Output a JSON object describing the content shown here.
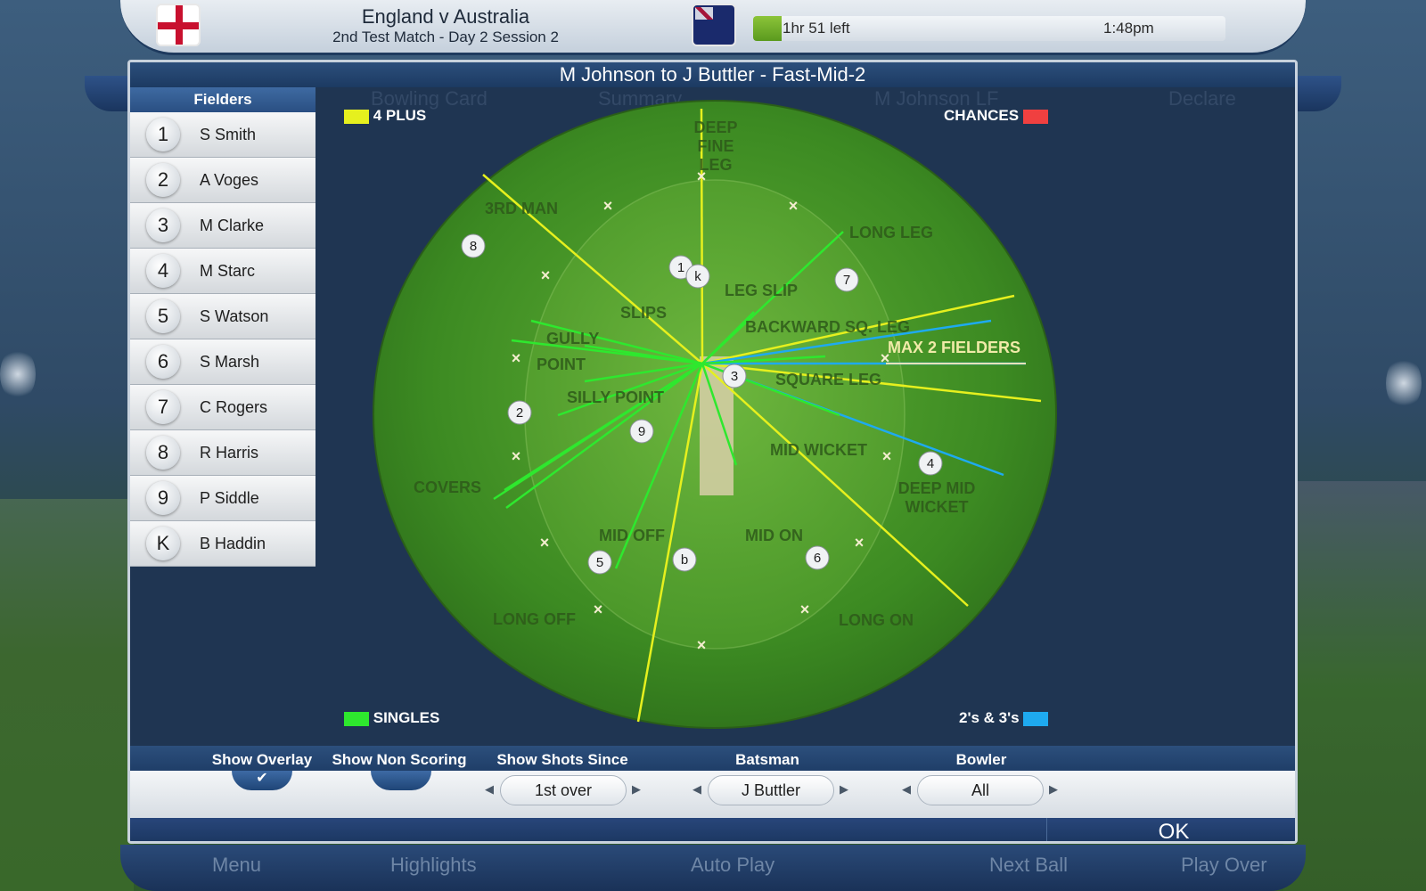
{
  "header": {
    "match_title": "England v Australia",
    "match_subtitle": "2nd Test Match - Day 2 Session 2",
    "time_left": "1hr 51 left",
    "clock": "1:48pm",
    "time_progress": 0.06
  },
  "dialog": {
    "title": "M Johnson to J Buttler - Fast-Mid-2",
    "background_ghost": {
      "bowling_card": "Bowling Card",
      "summary": "Summary",
      "bowler": "M Johnson LF",
      "declare": "Declare"
    }
  },
  "fielders": {
    "header": "Fielders",
    "items": [
      {
        "badge": "1",
        "name": "S Smith"
      },
      {
        "badge": "2",
        "name": "A Voges"
      },
      {
        "badge": "3",
        "name": "M Clarke"
      },
      {
        "badge": "4",
        "name": "M Starc"
      },
      {
        "badge": "5",
        "name": "S Watson"
      },
      {
        "badge": "6",
        "name": "S Marsh"
      },
      {
        "badge": "7",
        "name": "C Rogers"
      },
      {
        "badge": "8",
        "name": "R Harris"
      },
      {
        "badge": "9",
        "name": "P Siddle"
      },
      {
        "badge": "K",
        "name": "B Haddin"
      }
    ]
  },
  "legend": {
    "four_plus": "4 PLUS",
    "chances": "CHANCES",
    "singles": "SINGLES",
    "twos_threes": "2's & 3's",
    "colors": {
      "four_plus": "#e6f01e",
      "chances": "#f04040",
      "singles": "#2ee82e",
      "twos_threes": "#1eaaf0"
    }
  },
  "field": {
    "positions": {
      "deep_fine_leg": "DEEP\nFINE\nLEG",
      "third_man": "3RD MAN",
      "long_leg": "LONG LEG",
      "leg_slip": "LEG SLIP",
      "slips": "SLIPS",
      "gully": "GULLY",
      "point": "POINT",
      "backward_sq_leg": "BACKWARD SQ. LEG",
      "max_fielders": "MAX 2 FIELDERS",
      "square_leg": "SQUARE LEG",
      "silly_point": "SILLY POINT",
      "mid_wicket": "MID WICKET",
      "deep_mid_wicket_1": "DEEP MID",
      "deep_mid_wicket_2": "WICKET",
      "covers": "COVERS",
      "mid_off": "MID OFF",
      "mid_on": "MID ON",
      "long_off": "LONG OFF",
      "long_on": "LONG ON"
    },
    "markers": [
      "8",
      "1",
      "k",
      "7",
      "3",
      "2",
      "9",
      "4",
      "5",
      "b",
      "6"
    ]
  },
  "controls": {
    "show_overlay": "Show Overlay",
    "show_overlay_checked": true,
    "show_non_scoring": "Show Non Scoring",
    "show_non_scoring_checked": false,
    "show_shots_since": "Show Shots Since",
    "shots_since_value": "1st over",
    "batsman": "Batsman",
    "batsman_value": "J Buttler",
    "bowler": "Bowler",
    "bowler_value": "All",
    "check_glyph": "✔",
    "arrow_left": "◀",
    "arrow_right": "▶"
  },
  "ok": "OK",
  "bottom_nav": {
    "menu": "Menu",
    "highlights": "Highlights",
    "auto_play": "Auto Play",
    "next_ball": "Next Ball",
    "play_over": "Play Over"
  }
}
